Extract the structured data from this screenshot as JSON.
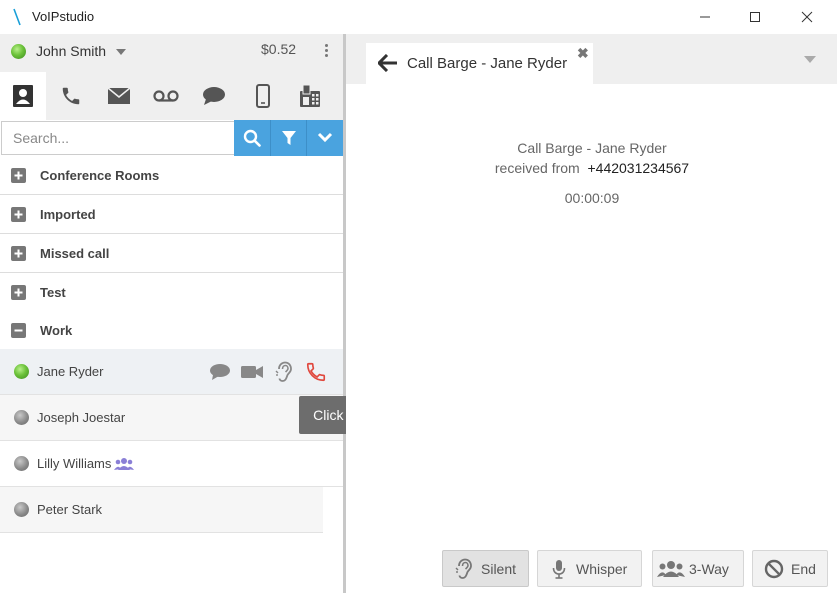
{
  "window": {
    "title": "VoIPstudio"
  },
  "user": {
    "name": "John Smith",
    "balance": "$0.52"
  },
  "search": {
    "placeholder": "Search..."
  },
  "groups": [
    {
      "label": "Conference Rooms",
      "expanded": false
    },
    {
      "label": "Imported",
      "expanded": false
    },
    {
      "label": "Missed call",
      "expanded": false
    },
    {
      "label": "Test",
      "expanded": false
    },
    {
      "label": "Work",
      "expanded": true
    }
  ],
  "contacts": [
    {
      "name": "Jane Ryder",
      "status": "online"
    },
    {
      "name": "Joseph Joestar",
      "status": "offline"
    },
    {
      "name": "Lilly Williams",
      "status": "offline"
    },
    {
      "name": "Peter Stark",
      "status": "offline"
    }
  ],
  "tooltip": {
    "text": "Click to Barge In"
  },
  "call_tab": {
    "title": "Call Barge - Jane Ryder"
  },
  "call": {
    "title": "Call Barge - Jane Ryder",
    "received_label": "received from",
    "number": "+442031234567",
    "timer": "00:00:09"
  },
  "actions": {
    "silent": "Silent",
    "whisper": "Whisper",
    "three_way": "3-Way",
    "end": "End"
  },
  "colors": {
    "accent": "#4aa3df",
    "online": "#6cc23a",
    "call_red": "#e0483e",
    "group_icon": "#8a7fd6"
  }
}
